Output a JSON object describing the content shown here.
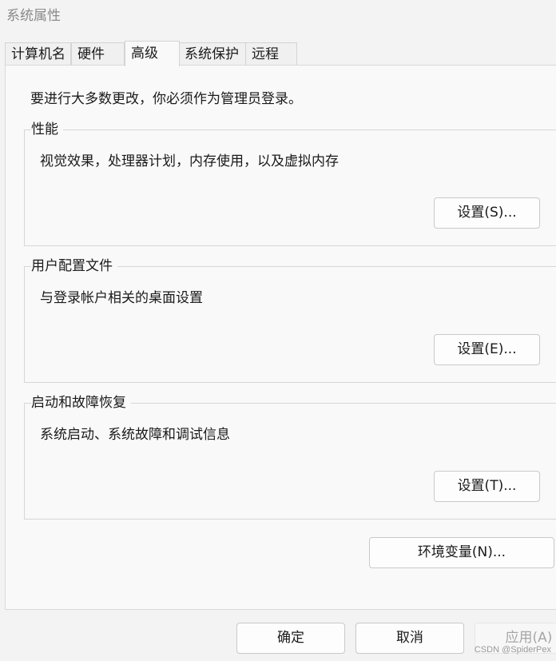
{
  "window": {
    "title": "系统属性"
  },
  "tabs": [
    {
      "label": "计算机名"
    },
    {
      "label": "硬件"
    },
    {
      "label": "高级",
      "active": true
    },
    {
      "label": "系统保护"
    },
    {
      "label": "远程"
    }
  ],
  "admin_note": "要进行大多数更改，你必须作为管理员登录。",
  "groups": {
    "performance": {
      "title": "性能",
      "description": "视觉效果，处理器计划，内存使用，以及虚拟内存",
      "button": "设置(S)..."
    },
    "user_profiles": {
      "title": "用户配置文件",
      "description": "与登录帐户相关的桌面设置",
      "button": "设置(E)..."
    },
    "startup_recovery": {
      "title": "启动和故障恢复",
      "description": "系统启动、系统故障和调试信息",
      "button": "设置(T)..."
    }
  },
  "env_button": "环境变量(N)...",
  "footer": {
    "ok": "确定",
    "cancel": "取消",
    "apply": "应用(A)"
  },
  "watermark": "CSDN @SpiderPex"
}
